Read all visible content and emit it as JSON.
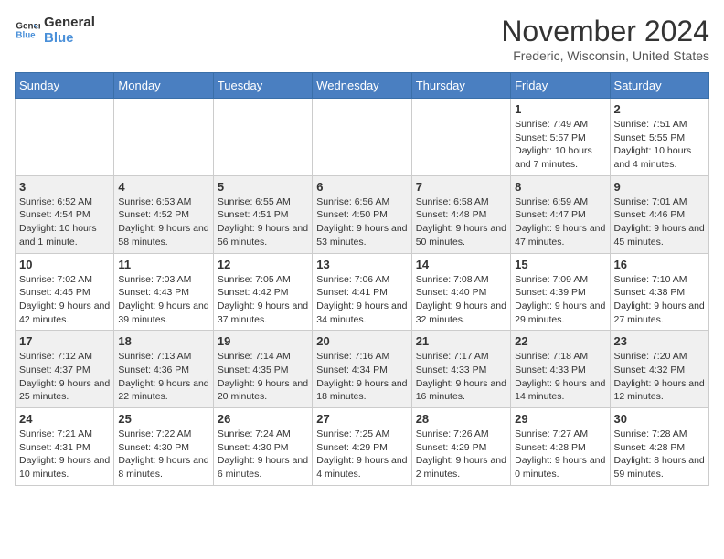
{
  "logo": {
    "line1": "General",
    "line2": "Blue"
  },
  "title": "November 2024",
  "location": "Frederic, Wisconsin, United States",
  "weekdays": [
    "Sunday",
    "Monday",
    "Tuesday",
    "Wednesday",
    "Thursday",
    "Friday",
    "Saturday"
  ],
  "weeks": [
    [
      {
        "day": "",
        "info": ""
      },
      {
        "day": "",
        "info": ""
      },
      {
        "day": "",
        "info": ""
      },
      {
        "day": "",
        "info": ""
      },
      {
        "day": "",
        "info": ""
      },
      {
        "day": "1",
        "info": "Sunrise: 7:49 AM\nSunset: 5:57 PM\nDaylight: 10 hours and 7 minutes."
      },
      {
        "day": "2",
        "info": "Sunrise: 7:51 AM\nSunset: 5:55 PM\nDaylight: 10 hours and 4 minutes."
      }
    ],
    [
      {
        "day": "3",
        "info": "Sunrise: 6:52 AM\nSunset: 4:54 PM\nDaylight: 10 hours and 1 minute."
      },
      {
        "day": "4",
        "info": "Sunrise: 6:53 AM\nSunset: 4:52 PM\nDaylight: 9 hours and 58 minutes."
      },
      {
        "day": "5",
        "info": "Sunrise: 6:55 AM\nSunset: 4:51 PM\nDaylight: 9 hours and 56 minutes."
      },
      {
        "day": "6",
        "info": "Sunrise: 6:56 AM\nSunset: 4:50 PM\nDaylight: 9 hours and 53 minutes."
      },
      {
        "day": "7",
        "info": "Sunrise: 6:58 AM\nSunset: 4:48 PM\nDaylight: 9 hours and 50 minutes."
      },
      {
        "day": "8",
        "info": "Sunrise: 6:59 AM\nSunset: 4:47 PM\nDaylight: 9 hours and 47 minutes."
      },
      {
        "day": "9",
        "info": "Sunrise: 7:01 AM\nSunset: 4:46 PM\nDaylight: 9 hours and 45 minutes."
      }
    ],
    [
      {
        "day": "10",
        "info": "Sunrise: 7:02 AM\nSunset: 4:45 PM\nDaylight: 9 hours and 42 minutes."
      },
      {
        "day": "11",
        "info": "Sunrise: 7:03 AM\nSunset: 4:43 PM\nDaylight: 9 hours and 39 minutes."
      },
      {
        "day": "12",
        "info": "Sunrise: 7:05 AM\nSunset: 4:42 PM\nDaylight: 9 hours and 37 minutes."
      },
      {
        "day": "13",
        "info": "Sunrise: 7:06 AM\nSunset: 4:41 PM\nDaylight: 9 hours and 34 minutes."
      },
      {
        "day": "14",
        "info": "Sunrise: 7:08 AM\nSunset: 4:40 PM\nDaylight: 9 hours and 32 minutes."
      },
      {
        "day": "15",
        "info": "Sunrise: 7:09 AM\nSunset: 4:39 PM\nDaylight: 9 hours and 29 minutes."
      },
      {
        "day": "16",
        "info": "Sunrise: 7:10 AM\nSunset: 4:38 PM\nDaylight: 9 hours and 27 minutes."
      }
    ],
    [
      {
        "day": "17",
        "info": "Sunrise: 7:12 AM\nSunset: 4:37 PM\nDaylight: 9 hours and 25 minutes."
      },
      {
        "day": "18",
        "info": "Sunrise: 7:13 AM\nSunset: 4:36 PM\nDaylight: 9 hours and 22 minutes."
      },
      {
        "day": "19",
        "info": "Sunrise: 7:14 AM\nSunset: 4:35 PM\nDaylight: 9 hours and 20 minutes."
      },
      {
        "day": "20",
        "info": "Sunrise: 7:16 AM\nSunset: 4:34 PM\nDaylight: 9 hours and 18 minutes."
      },
      {
        "day": "21",
        "info": "Sunrise: 7:17 AM\nSunset: 4:33 PM\nDaylight: 9 hours and 16 minutes."
      },
      {
        "day": "22",
        "info": "Sunrise: 7:18 AM\nSunset: 4:33 PM\nDaylight: 9 hours and 14 minutes."
      },
      {
        "day": "23",
        "info": "Sunrise: 7:20 AM\nSunset: 4:32 PM\nDaylight: 9 hours and 12 minutes."
      }
    ],
    [
      {
        "day": "24",
        "info": "Sunrise: 7:21 AM\nSunset: 4:31 PM\nDaylight: 9 hours and 10 minutes."
      },
      {
        "day": "25",
        "info": "Sunrise: 7:22 AM\nSunset: 4:30 PM\nDaylight: 9 hours and 8 minutes."
      },
      {
        "day": "26",
        "info": "Sunrise: 7:24 AM\nSunset: 4:30 PM\nDaylight: 9 hours and 6 minutes."
      },
      {
        "day": "27",
        "info": "Sunrise: 7:25 AM\nSunset: 4:29 PM\nDaylight: 9 hours and 4 minutes."
      },
      {
        "day": "28",
        "info": "Sunrise: 7:26 AM\nSunset: 4:29 PM\nDaylight: 9 hours and 2 minutes."
      },
      {
        "day": "29",
        "info": "Sunrise: 7:27 AM\nSunset: 4:28 PM\nDaylight: 9 hours and 0 minutes."
      },
      {
        "day": "30",
        "info": "Sunrise: 7:28 AM\nSunset: 4:28 PM\nDaylight: 8 hours and 59 minutes."
      }
    ]
  ]
}
